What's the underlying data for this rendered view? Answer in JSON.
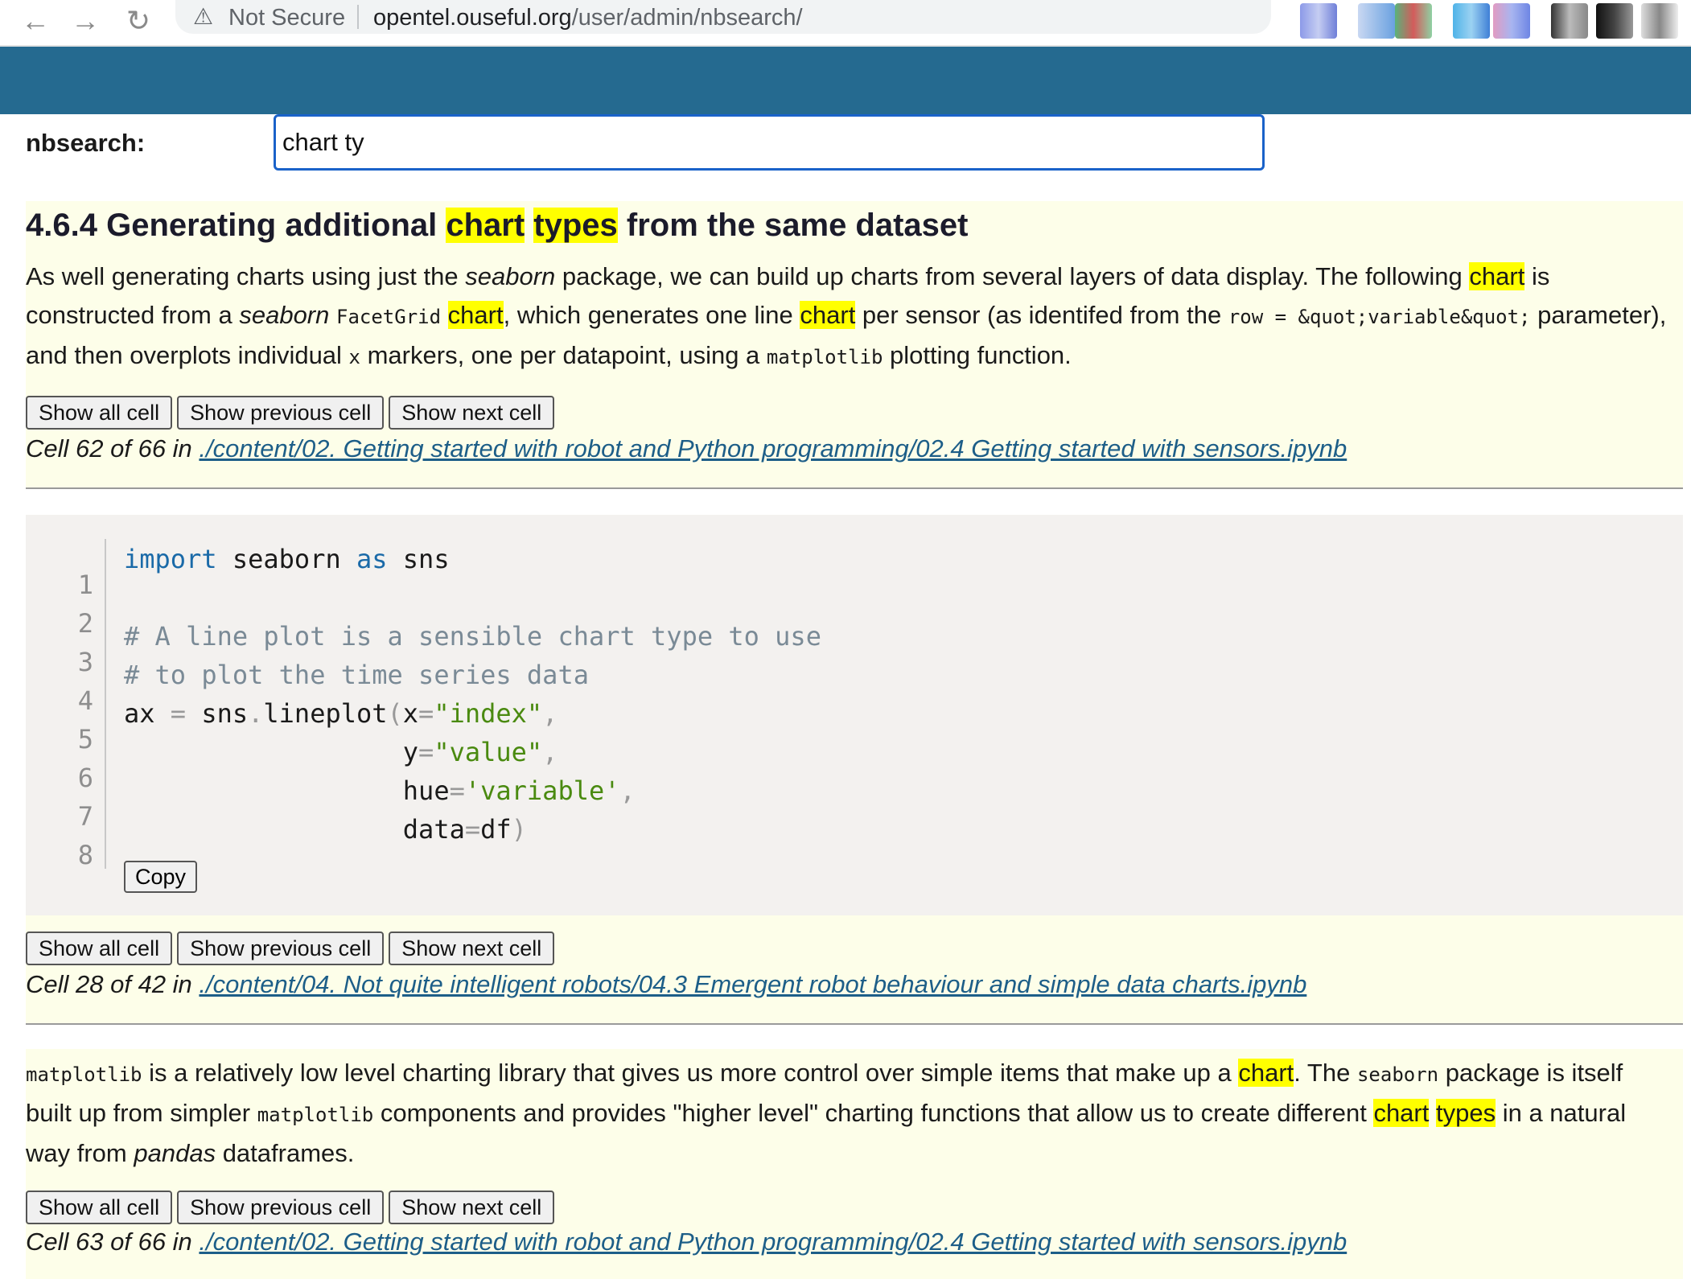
{
  "browser": {
    "back_icon": "←",
    "forward_icon": "→",
    "reload_icon": "↻",
    "warning_icon": "⚠",
    "security_label": "Not Secure",
    "url_host": "opentel.ouseful.org",
    "url_path": "/user/admin/nbsearch/",
    "star_icon": "☆"
  },
  "search": {
    "label": "nbsearch:",
    "value": "chart ty"
  },
  "buttons": {
    "show_all": "Show all cell",
    "show_previous": "Show previous cell",
    "show_next": "Show next cell",
    "copy": "Copy"
  },
  "results": [
    {
      "heading": {
        "prefix": "4.6.4 Generating additional ",
        "hl1": "chart",
        "sep": " ",
        "hl2": "types",
        "suffix": " from the same dataset"
      },
      "body": {
        "t1": "As well generating charts using just the ",
        "i1": "seaborn",
        "t2": " package, we can build up charts from several layers of data display. The following ",
        "h1": "chart",
        "t3": " is constructed from a ",
        "i2": "seaborn",
        "t4": " ",
        "c1": "FacetGrid",
        "t5": " ",
        "h2": "chart",
        "t6": ", which generates one line ",
        "h3": "chart",
        "t7": " per sensor (as identifed from the ",
        "c2": "row = &quot;variable&quot;",
        "t8": " parameter), and then overplots individual ",
        "c3": "x",
        "t9": " markers, one per datapoint, using a ",
        "c4": "matplotlib",
        "t10": " plotting function."
      },
      "location_prefix": "Cell 62 of 66 in ",
      "location_link": "./content/02. Getting started with robot and Python programming/02.4 Getting started with sensors.ipynb"
    },
    {
      "code": {
        "line_numbers": [
          "1",
          "2",
          "3",
          "4",
          "5",
          "6",
          "7",
          "8"
        ],
        "l1": {
          "kw1": "import",
          "t1": " seaborn ",
          "kw2": "as",
          "t2": " sns"
        },
        "l3": "# A line plot is a sensible chart type to use",
        "l4": "# to plot the time series data",
        "l5": {
          "a": "ax ",
          "eq": "=",
          "b": " sns",
          "dot": ".",
          "c": "lineplot",
          "p": "(",
          "d": "x",
          "eq2": "=",
          "s": "\"index\"",
          "comma": ","
        },
        "l6": {
          "indent": "                  ",
          "d": "y",
          "eq": "=",
          "s": "\"value\"",
          "comma": ","
        },
        "l7": {
          "indent": "                  ",
          "d": "hue",
          "eq": "=",
          "s": "'variable'",
          "comma": ","
        },
        "l8": {
          "indent": "                  ",
          "d": "data",
          "eq": "=",
          "v": "df",
          "p": ")"
        }
      },
      "location_prefix": "Cell 28 of 42 in ",
      "location_link": "./content/04. Not quite intelligent robots/04.3 Emergent robot behaviour and simple data charts.ipynb"
    },
    {
      "body": {
        "c1": "matplotlib",
        "t1": " is a relatively low level charting library that gives us more control over simple items that make up a ",
        "h1": "chart",
        "t2": ". The ",
        "c2": "seaborn",
        "t3": " package is itself built up from simpler ",
        "c3": "matplotlib",
        "t4": " components and provides \"higher level\" charting functions that allow us to create different ",
        "h2": "chart",
        "sep": " ",
        "h3": "types",
        "t5": " in a natural way from ",
        "i1": "pandas",
        "t6": " dataframes."
      },
      "location_prefix": "Cell 63 of 66 in ",
      "location_link": "./content/02. Getting started with robot and Python programming/02.4 Getting started with sensors.ipynb"
    }
  ],
  "colors": {
    "banner": "#256a90",
    "highlight": "#ffff00",
    "card_background": "#fdfee9",
    "link": "#1d5e88"
  }
}
